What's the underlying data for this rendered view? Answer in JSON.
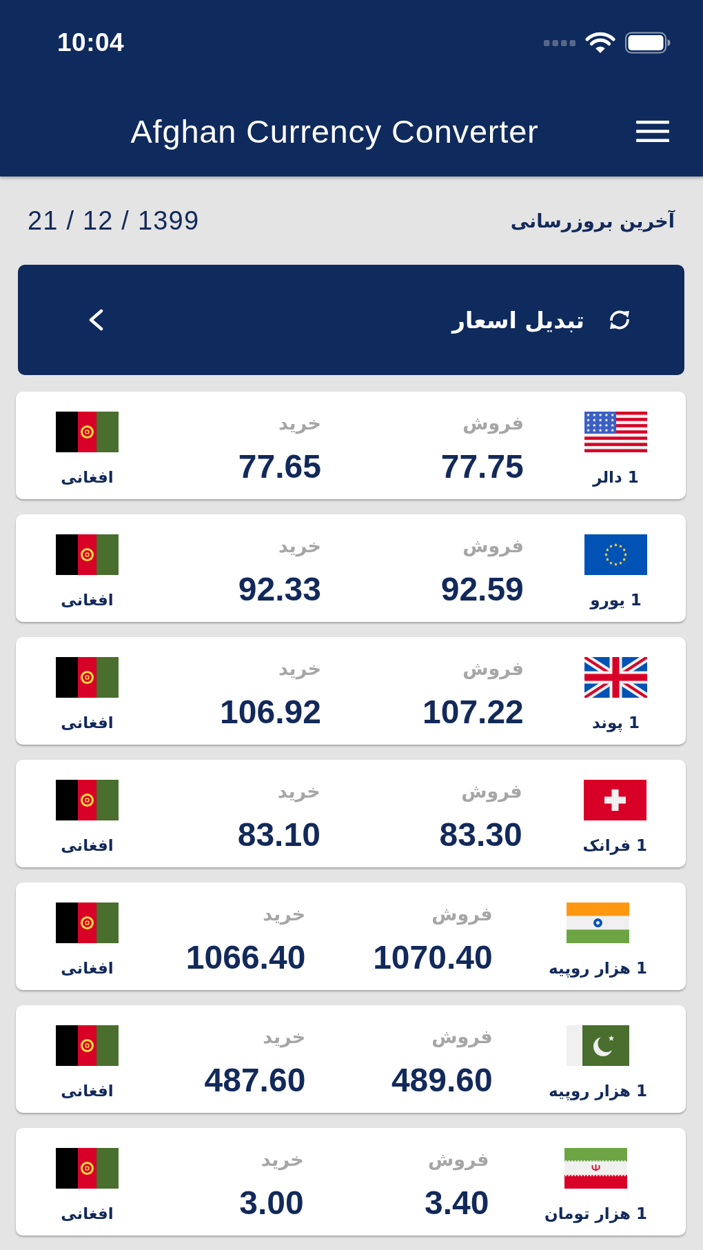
{
  "status_bar": {
    "time": "10:04"
  },
  "app_bar": {
    "title": "Afghan Currency Converter"
  },
  "last_update": {
    "label": "آخرین بروزرسانی",
    "date": "21 / 12 / 1399"
  },
  "convert_panel": {
    "title": "تبدیل اسعار"
  },
  "rates": [
    {
      "currency": "1 دالر",
      "sell_label": "فروش",
      "sell": "77.75",
      "buy_label": "خرید",
      "buy": "77.65",
      "base": "افغانی"
    },
    {
      "currency": "1 یورو",
      "sell_label": "فروش",
      "sell": "92.59",
      "buy_label": "خرید",
      "buy": "92.33",
      "base": "افغانی"
    },
    {
      "currency": "1 پوند",
      "sell_label": "فروش",
      "sell": "107.22",
      "buy_label": "خرید",
      "buy": "106.92",
      "base": "افغانی"
    },
    {
      "currency": "1 فرانک",
      "sell_label": "فروش",
      "sell": "83.30",
      "buy_label": "خرید",
      "buy": "83.10",
      "base": "افغانی"
    },
    {
      "currency": "1 هزار روپیه",
      "sell_label": "فروش",
      "sell": "1070.40",
      "buy_label": "خرید",
      "buy": "1066.40",
      "base": "افغانی"
    },
    {
      "currency": "1 هزار روپیه",
      "sell_label": "فروش",
      "sell": "489.60",
      "buy_label": "خرید",
      "buy": "487.60",
      "base": "افغانی"
    },
    {
      "currency": "1 هزار تومان",
      "sell_label": "فروش",
      "sell": "3.40",
      "buy_label": "خرید",
      "buy": "3.00",
      "base": "افغانی"
    }
  ]
}
